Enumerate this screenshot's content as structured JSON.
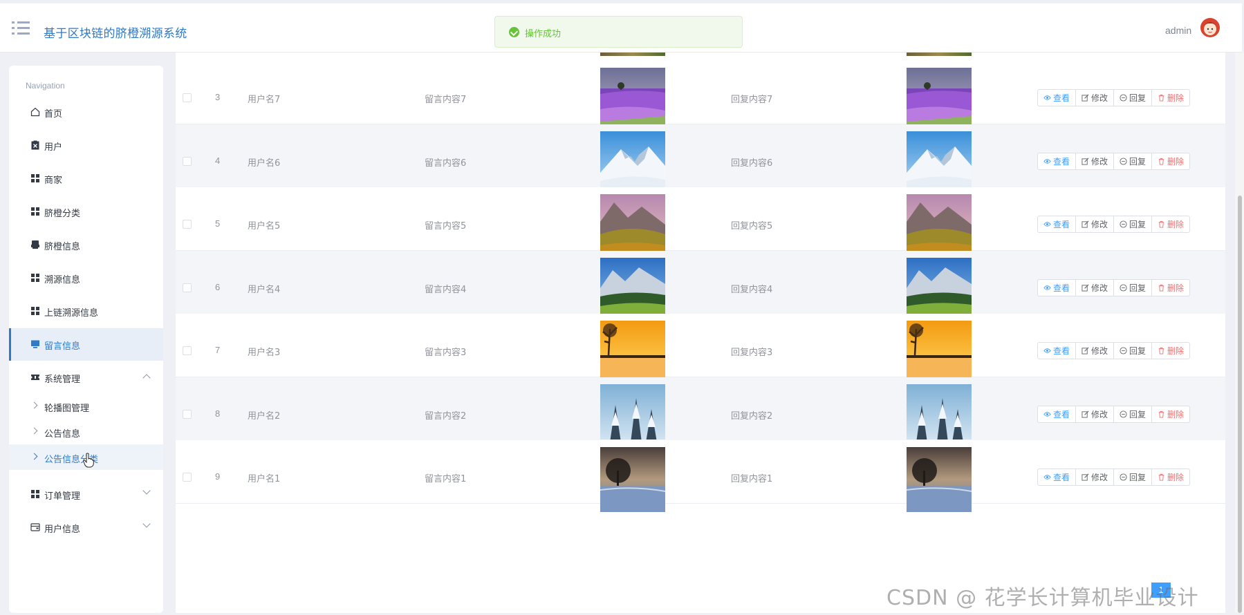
{
  "header": {
    "title": "基于区块链的脐橙溯源系统",
    "user": "admin"
  },
  "toast": {
    "message": "操作成功"
  },
  "sidebar": {
    "caption": "Navigation",
    "items": [
      {
        "label": "首页",
        "icon": "home-icon"
      },
      {
        "label": "用户",
        "icon": "clipboard-icon"
      },
      {
        "label": "商家",
        "icon": "grid-icon"
      },
      {
        "label": "脐橙分类",
        "icon": "grid-icon"
      },
      {
        "label": "脐橙信息",
        "icon": "printer-icon"
      },
      {
        "label": "溯源信息",
        "icon": "grid-icon"
      },
      {
        "label": "上链溯源信息",
        "icon": "grid-icon"
      },
      {
        "label": "留言信息",
        "icon": "monitor-icon",
        "active": true
      },
      {
        "label": "系统管理",
        "icon": "ticket-icon",
        "expanded": true
      },
      {
        "label": "订单管理",
        "icon": "grid-icon"
      },
      {
        "label": "用户信息",
        "icon": "wallet-icon"
      }
    ],
    "sub_items": [
      {
        "label": "轮播图管理"
      },
      {
        "label": "公告信息"
      },
      {
        "label": "公告信息分类"
      }
    ]
  },
  "table": {
    "rows": [
      {
        "index": "3",
        "user": "用户名7",
        "message": "留言内容7",
        "reply": "回复内容7",
        "image": "lavender-field"
      },
      {
        "index": "4",
        "user": "用户名6",
        "message": "留言内容6",
        "reply": "回复内容6",
        "image": "snow-mountain"
      },
      {
        "index": "5",
        "user": "用户名5",
        "message": "留言内容5",
        "reply": "回复内容5",
        "image": "autumn-valley"
      },
      {
        "index": "6",
        "user": "用户名4",
        "message": "留言内容4",
        "reply": "回复内容4",
        "image": "alpine-meadow"
      },
      {
        "index": "7",
        "user": "用户名3",
        "message": "留言内容3",
        "reply": "回复内容3",
        "image": "sunset-lake"
      },
      {
        "index": "8",
        "user": "用户名2",
        "message": "留言内容2",
        "reply": "回复内容2",
        "image": "snowy-forest"
      },
      {
        "index": "9",
        "user": "用户名1",
        "message": "留言内容1",
        "reply": "回复内容1",
        "image": "misty-tree"
      }
    ],
    "actions": {
      "view": "查看",
      "edit": "修改",
      "reply": "回复",
      "delete": "删除"
    }
  },
  "pagination": {
    "current": "1"
  },
  "watermark": "CSDN @ 花学长计算机毕业设计",
  "colors": {
    "accent": "#2f79c8",
    "primary_button": "#409eff",
    "danger": "#f56c6c",
    "success": "#67c23a"
  }
}
